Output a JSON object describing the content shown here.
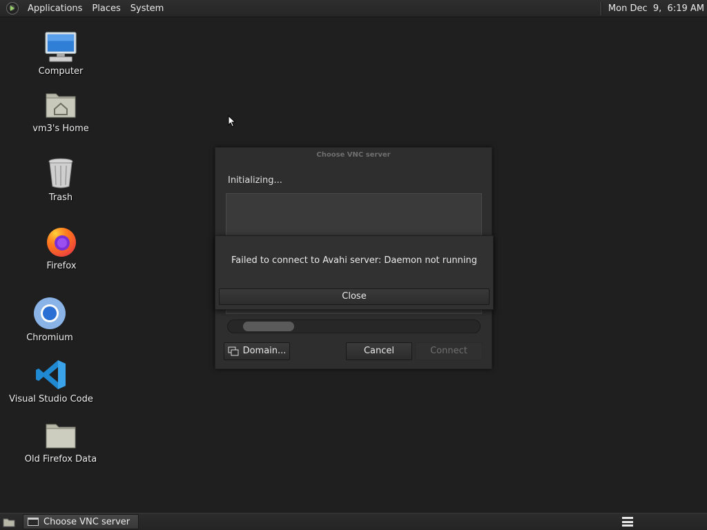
{
  "top_panel": {
    "menus": [
      "Applications",
      "Places",
      "System"
    ],
    "clock": "Mon Dec  9,  6:19 AM"
  },
  "desktop_icons": [
    {
      "label": "Computer",
      "icon": "computer-icon"
    },
    {
      "label": "vm3's Home",
      "icon": "home-folder-icon"
    },
    {
      "label": "Trash",
      "icon": "trash-icon"
    },
    {
      "label": "Firefox",
      "icon": "firefox-icon"
    },
    {
      "label": "Chromium",
      "icon": "chromium-icon"
    },
    {
      "label": "Visual Studio Code",
      "icon": "vscode-icon"
    },
    {
      "label": "Old Firefox Data",
      "icon": "folder-icon"
    }
  ],
  "vnc_dialog": {
    "title": "Choose VNC server",
    "status": "Initializing...",
    "buttons": {
      "domain": "Domain...",
      "cancel": "Cancel",
      "connect": "Connect"
    },
    "connect_enabled": false,
    "progress_indeterminate": true
  },
  "error_dialog": {
    "message": "Failed to connect to Avahi server: Daemon not running",
    "close_label": "Close"
  },
  "bottom_panel": {
    "tasks": [
      {
        "label": "Choose VNC server"
      }
    ]
  },
  "colors": {
    "desktop_bg": "#1f1f1f",
    "panel_bg": "#2a2a2a",
    "dialog_bg": "#2e2e2e",
    "text": "#e8e8e8",
    "disabled_text": "#707070"
  }
}
